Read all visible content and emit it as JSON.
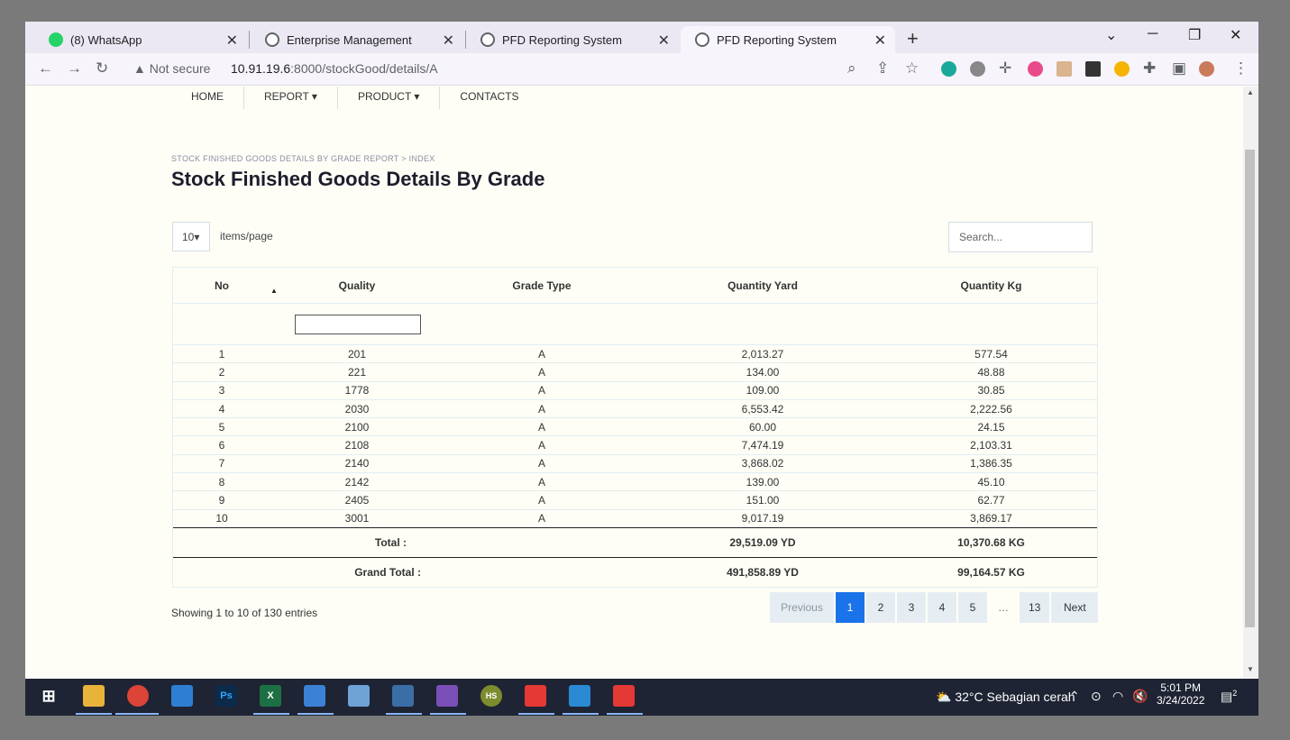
{
  "browser": {
    "tabs": [
      {
        "title": "(8) WhatsApp",
        "icon": "whatsapp-icon",
        "active": false
      },
      {
        "title": "Enterprise Management",
        "icon": "globe-icon",
        "active": false
      },
      {
        "title": "PFD Reporting System",
        "icon": "globe-icon",
        "active": false
      },
      {
        "title": "PFD Reporting System",
        "icon": "globe-icon",
        "active": true
      }
    ],
    "security_label": "Not secure",
    "url_host": "10.91.19.6",
    "url_rest": ":8000/stockGood/details/A"
  },
  "nav": {
    "items": [
      "HOME",
      "REPORT ▾",
      "PRODUCT ▾",
      "CONTACTS"
    ]
  },
  "breadcrumb": "STOCK FINISHED GOODS DETAILS BY GRADE REPORT > INDEX",
  "page_title": "Stock Finished Goods Details By Grade",
  "controls": {
    "page_length": "10▾",
    "page_length_label": "items/page",
    "search_placeholder": "Search..."
  },
  "table": {
    "columns": [
      "No",
      "Quality",
      "Grade Type",
      "Quantity Yard",
      "Quantity Kg"
    ],
    "rows": [
      [
        "1",
        "201",
        "A",
        "2,013.27",
        "577.54"
      ],
      [
        "2",
        "221",
        "A",
        "134.00",
        "48.88"
      ],
      [
        "3",
        "1778",
        "A",
        "109.00",
        "30.85"
      ],
      [
        "4",
        "2030",
        "A",
        "6,553.42",
        "2,222.56"
      ],
      [
        "5",
        "2100",
        "A",
        "60.00",
        "24.15"
      ],
      [
        "6",
        "2108",
        "A",
        "7,474.19",
        "2,103.31"
      ],
      [
        "7",
        "2140",
        "A",
        "3,868.02",
        "1,386.35"
      ],
      [
        "8",
        "2142",
        "A",
        "139.00",
        "45.10"
      ],
      [
        "9",
        "2405",
        "A",
        "151.00",
        "62.77"
      ],
      [
        "10",
        "3001",
        "A",
        "9,017.19",
        "3,869.17"
      ]
    ],
    "total_label": "Total :",
    "total_yard": "29,519.09 YD",
    "total_kg": "10,370.68 KG",
    "grand_total_label": "Grand Total :",
    "grand_total_yard": "491,858.89 YD",
    "grand_total_kg": "99,164.57 KG"
  },
  "info": "Showing 1 to 10 of 130 entries",
  "pagination": {
    "previous": "Previous",
    "pages": [
      "1",
      "2",
      "3",
      "4",
      "5"
    ],
    "ellipsis": "…",
    "last": "13",
    "next": "Next",
    "current": "1"
  },
  "taskbar": {
    "weather": "32°C  Sebagian cerah",
    "time": "5:01 PM",
    "date": "3/24/2022",
    "notification_count": "2"
  },
  "colors": {
    "accent": "#1a73e8",
    "page_bg": "#fefef6",
    "taskbar_bg": "#1e2433"
  }
}
